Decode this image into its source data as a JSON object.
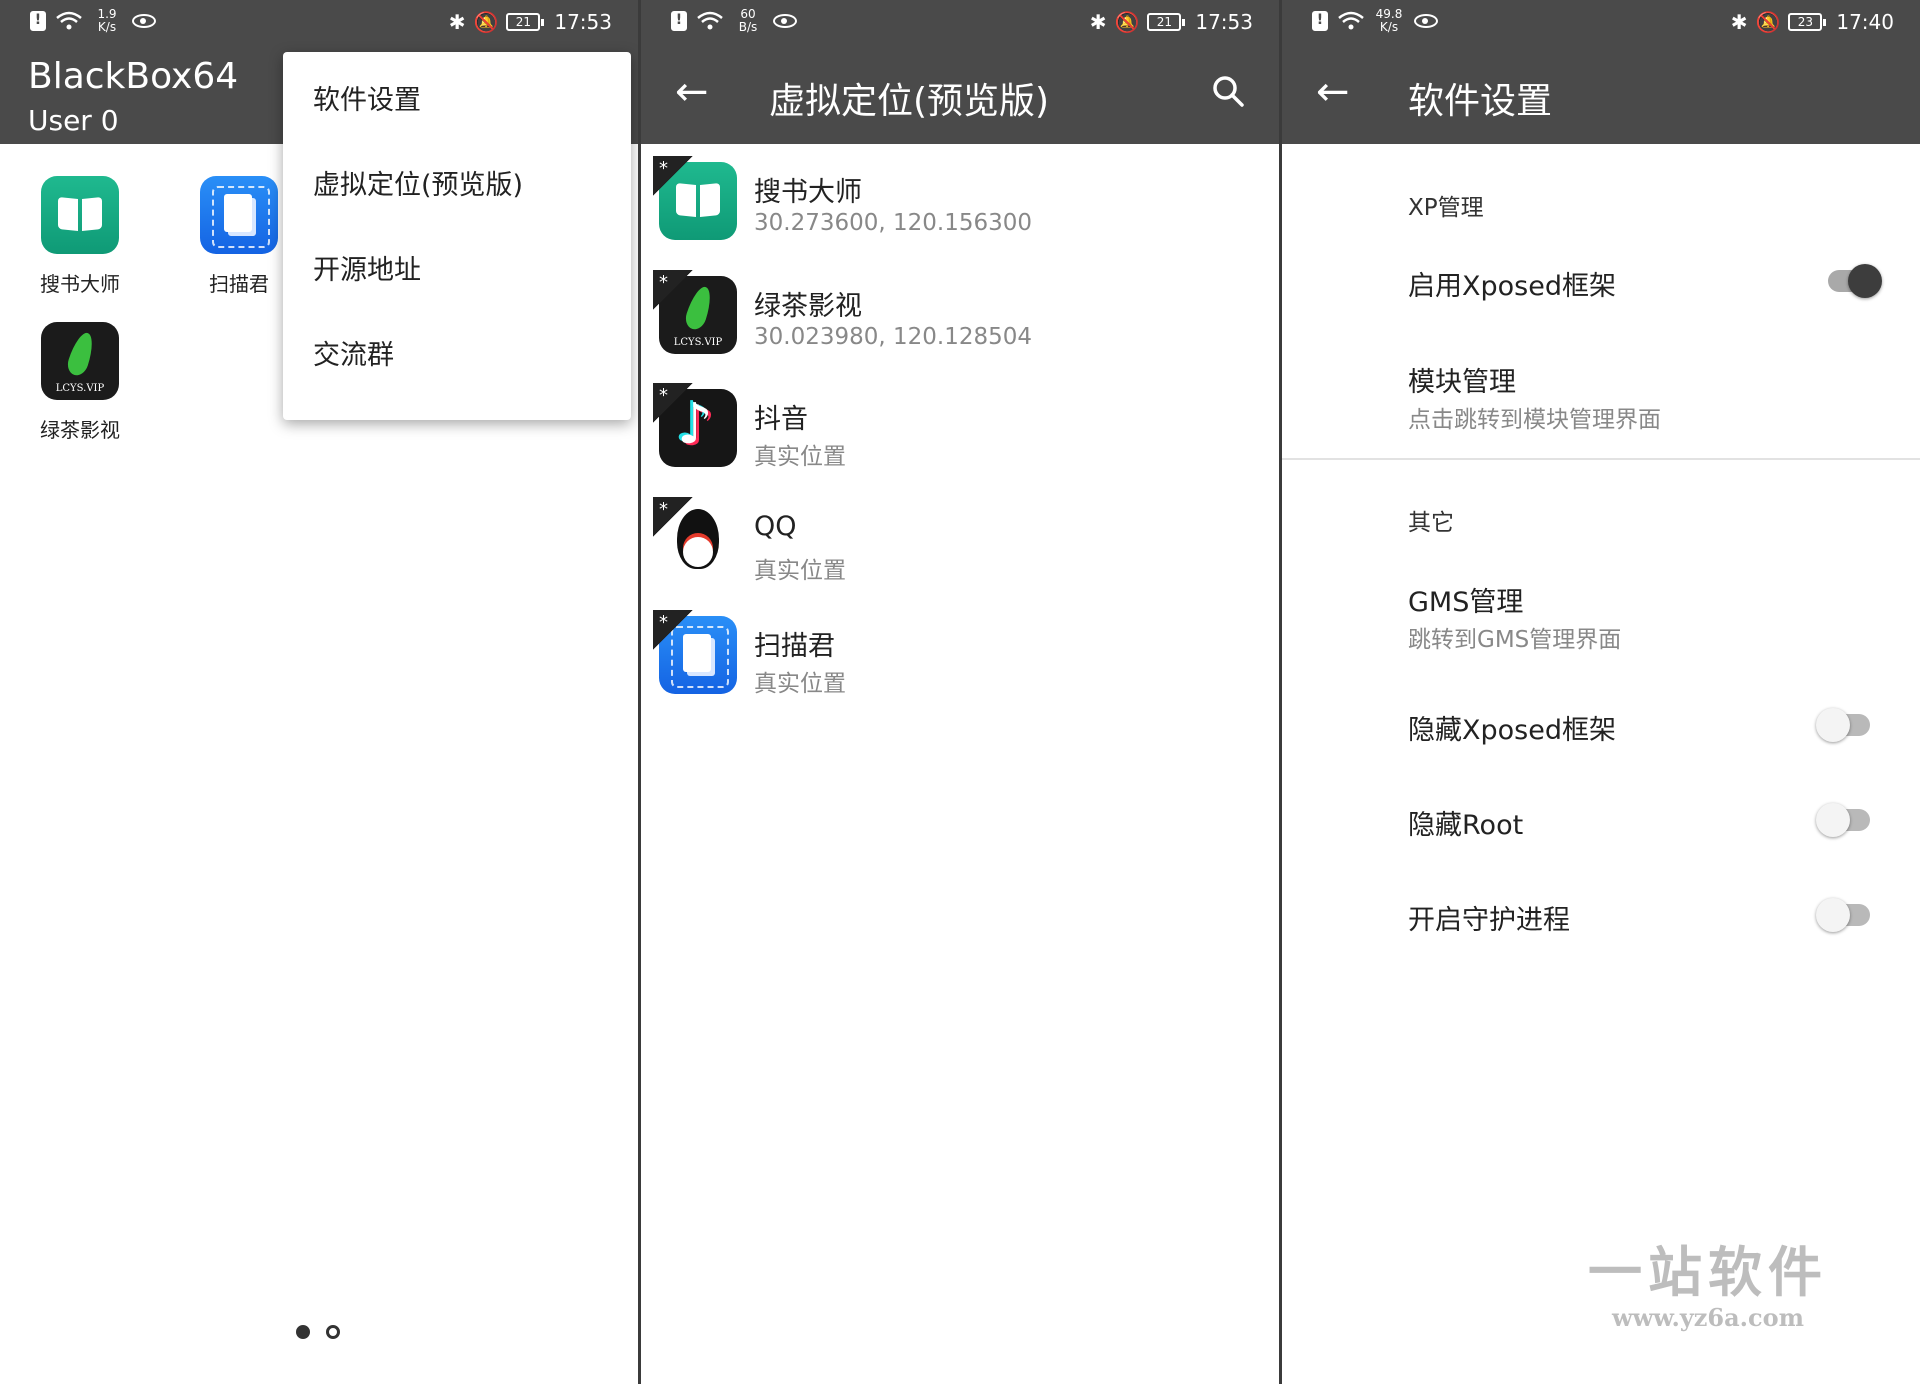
{
  "screen1": {
    "status": {
      "speed_top": "1.9",
      "speed_unit": "K/s",
      "battery": "21",
      "time": "17:53"
    },
    "app_title": "BlackBox64",
    "app_subtitle": "User 0",
    "apps": [
      {
        "label": "搜书大师",
        "icon": "book-icon"
      },
      {
        "label": "扫描君",
        "icon": "scan-document-icon"
      },
      {
        "label": "绿茶影视",
        "icon": "leaf-icon"
      }
    ],
    "menu": [
      "软件设置",
      "虚拟定位(预览版)",
      "开源地址",
      "交流群"
    ],
    "pages": {
      "count": 2,
      "current": 1
    }
  },
  "screen2": {
    "status": {
      "speed_top": "60",
      "speed_unit": "B/s",
      "battery": "21",
      "time": "17:53"
    },
    "title": "虚拟定位(预览版)",
    "items": [
      {
        "name": "搜书大师",
        "location": "30.273600, 120.156300",
        "icon": "book-icon"
      },
      {
        "name": "绿茶影视",
        "location": "30.023980, 120.128504",
        "icon": "leaf-icon"
      },
      {
        "name": "抖音",
        "location": "真实位置",
        "icon": "tiktok-icon"
      },
      {
        "name": "QQ",
        "location": "真实位置",
        "icon": "qq-penguin-icon"
      },
      {
        "name": "扫描君",
        "location": "真实位置",
        "icon": "scan-document-icon"
      }
    ],
    "corner_mark": "*"
  },
  "screen3": {
    "status": {
      "speed_top": "49.8",
      "speed_unit": "K/s",
      "battery": "23",
      "time": "17:40"
    },
    "title": "软件设置",
    "section1": "XP管理",
    "enable_xposed": {
      "label": "启用Xposed框架",
      "on": true
    },
    "module_mgmt": {
      "label": "模块管理",
      "sub": "点击跳转到模块管理界面"
    },
    "section2": "其它",
    "gms_mgmt": {
      "label": "GMS管理",
      "sub": "跳转到GMS管理界面"
    },
    "hide_xposed": {
      "label": "隐藏Xposed框架",
      "on": false
    },
    "hide_root": {
      "label": "隐藏Root",
      "on": false
    },
    "daemon": {
      "label": "开启守护进程",
      "on": false
    }
  },
  "watermark": {
    "big": "一站软件",
    "small": "www.yz6a.com"
  },
  "colors": {
    "bar": "#4a4a4a",
    "text": "#222222",
    "secondary": "#888888"
  }
}
